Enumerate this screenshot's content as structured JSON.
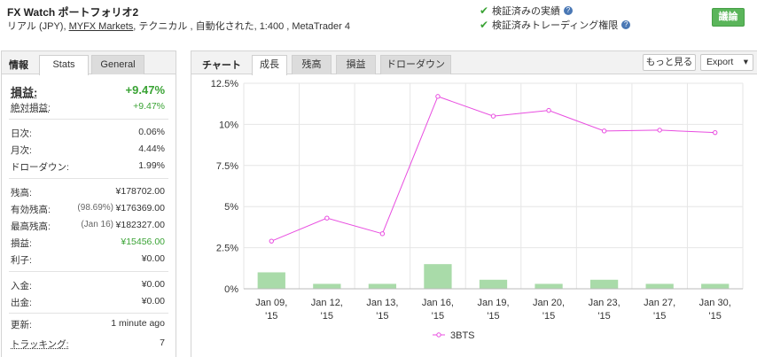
{
  "header": {
    "title": "FX Watch ポートフォリオ2",
    "subtitle_pre": "リアル (JPY), ",
    "broker": "MYFX Markets",
    "subtitle_post": ", テクニカル , 自動化された, 1:400 , MetaTrader 4",
    "verified_track": "検証済みの実績",
    "verified_trading": "検証済みトレーディング権限",
    "help_glyph": "?",
    "check_glyph": "✔",
    "discuss_button": "議論"
  },
  "left": {
    "title": "情報",
    "tabs": [
      "Stats",
      "General"
    ],
    "gain": {
      "label": "損益:",
      "value": "+9.47%"
    },
    "abs_gain": {
      "label": "絶対損益:",
      "value": "+9.47%"
    },
    "daily": {
      "label": "日次:",
      "value": "0.06%"
    },
    "monthly": {
      "label": "月次:",
      "value": "4.44%"
    },
    "drawdown": {
      "label": "ドローダウン:",
      "value": "1.99%"
    },
    "balance": {
      "label": "残高:",
      "value": "¥178702.00"
    },
    "equity": {
      "label": "有効残高:",
      "note": "(98.69%)",
      "value": "¥176369.00"
    },
    "highest": {
      "label": "最高残高:",
      "note": "(Jan 16)",
      "value": "¥182327.00"
    },
    "profit": {
      "label": "損益:",
      "value": "¥15456.00"
    },
    "interest": {
      "label": "利子:",
      "value": "¥0.00"
    },
    "deposits": {
      "label": "入金:",
      "value": "¥0.00"
    },
    "withdrawals": {
      "label": "出金:",
      "value": "¥0.00"
    },
    "updated": {
      "label": "更新:",
      "value": "1 minute ago"
    },
    "tracking": {
      "label": "トラッキング:",
      "value": "7"
    }
  },
  "chart_panel": {
    "title": "チャート",
    "tabs": [
      "成長",
      "残高",
      "損益",
      "ドローダウン"
    ],
    "more_button": "もっと見る",
    "export_button": "Export",
    "dropdown_glyph": "▾"
  },
  "chart_data": {
    "type": "line",
    "categories": [
      "Jan 09, '15",
      "Jan 12, '15",
      "Jan 13, '15",
      "Jan 16, '15",
      "Jan 19, '15",
      "Jan 20, '15",
      "Jan 23, '15",
      "Jan 27, '15",
      "Jan 30, '15"
    ],
    "series": [
      {
        "name": "3BTS",
        "type": "line",
        "color": "#e84de0",
        "values": [
          2.9,
          4.3,
          3.35,
          11.7,
          10.5,
          10.85,
          9.6,
          9.65,
          9.5
        ]
      },
      {
        "type": "bar",
        "color": "#a9dba9",
        "values": [
          1.0,
          0.3,
          0.3,
          1.5,
          0.55,
          0.3,
          0.55,
          0.3,
          0.3
        ]
      }
    ],
    "y_ticks": [
      "0%",
      "2.5%",
      "5%",
      "7.5%",
      "10%",
      "12.5%"
    ],
    "ylim": [
      0,
      12.5
    ],
    "grid": true,
    "legend": "bottom"
  }
}
